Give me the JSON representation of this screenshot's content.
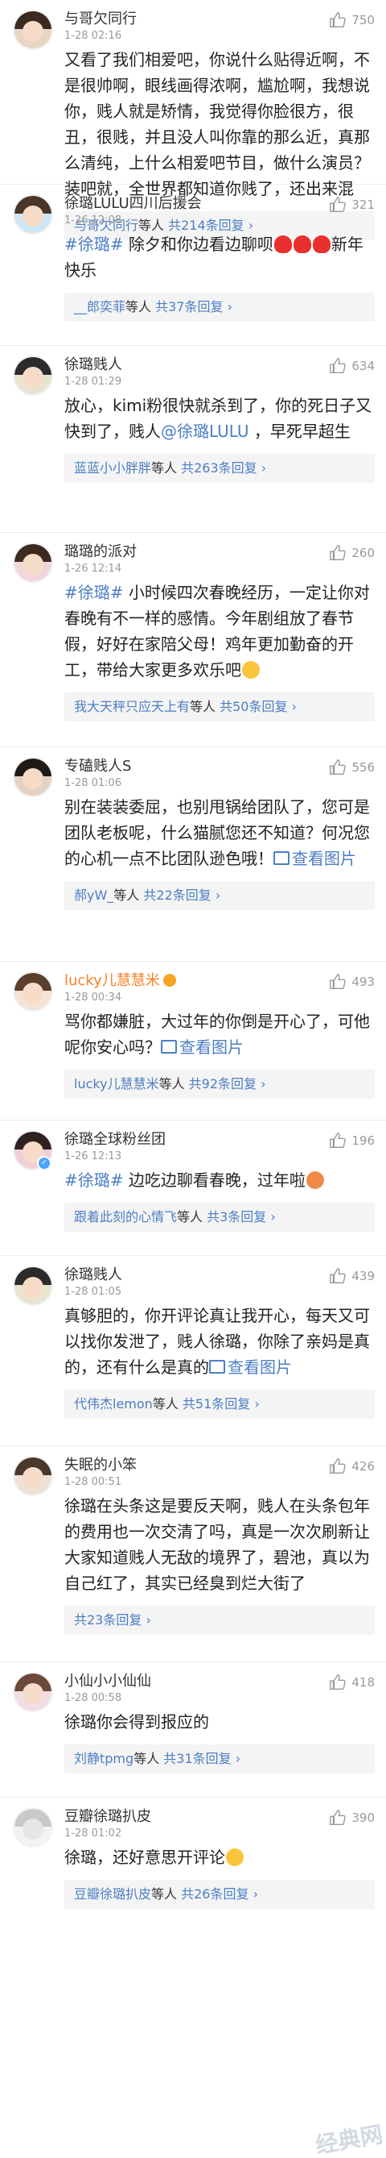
{
  "comments": [
    {
      "user": "与哥欠同行",
      "time": "1-28 02:16",
      "likes": "750",
      "text": "又看了我们相爱吧，你说什么贴得近啊，不是很帅啊，眼线画得浓啊，尴尬啊，我想说你，贱人就是矫情，我觉得你脸很方，很丑，很贱，并且没人叫你靠的那么近，真那么清纯，上什么相爱吧节目，做什么演员？装吧就，全世界都知道你贱了，还出来混",
      "reply_user": "与哥欠同行",
      "reply_mid": "等人 ",
      "reply_count": "共214条回复",
      "reply_arrow": "›"
    },
    {
      "user": "徐璐LULU四川后援会",
      "time": "1-26 12:08",
      "likes": "321",
      "topic": "#徐璐#",
      "text": " 除夕和你边看边聊呗",
      "text_after": "新年快乐",
      "reply_user": "__郎奕菲",
      "reply_mid": "等人 ",
      "reply_count": "共37条回复",
      "reply_arrow": "›"
    },
    {
      "user": "徐璐贱人",
      "time": "1-28 01:29",
      "likes": "634",
      "text": "放心，kimi粉很快就杀到了，你的死日子又快到了，贱人",
      "mention": "@徐璐LULU",
      "text_after": " ，早死早超生",
      "reply_user": "蓝蓝小小胖胖",
      "reply_mid": "等人 ",
      "reply_count": "共263条回复",
      "reply_arrow": "›"
    },
    {
      "user": "璐璐的派对",
      "time": "1-26 12:14",
      "likes": "260",
      "topic": "#徐璐#",
      "text": " 小时候四次春晚经历，一定让你对春晚有不一样的感情。今年剧组放了春节假，好好在家陪父母！鸡年更加勤奋的开工，带给大家更多欢乐吧",
      "reply_user": "我大天秤只应天上有",
      "reply_mid": "等人 ",
      "reply_count": "共50条回复",
      "reply_arrow": "›"
    },
    {
      "user": "专磕贱人S",
      "time": "1-28 01:06",
      "likes": "556",
      "text": "别在装装委屈，也别甩锅给团队了，您可是团队老板呢，什么猫腻您还不知道？何况您的心机一点不比团队逊色哦！",
      "img_label": "查看图片",
      "reply_user": "郝yW_",
      "reply_mid": "等人 ",
      "reply_count": "共22条回复",
      "reply_arrow": "›"
    },
    {
      "user": "lucky儿慧慧米",
      "time": "1-28 00:34",
      "likes": "493",
      "text": "骂你都嫌脏，大过年的你倒是开心了，可他呢你安心吗？",
      "img_label": "查看图片",
      "reply_user": "lucky儿慧慧米",
      "reply_mid": "等人 ",
      "reply_count": "共92条回复",
      "reply_arrow": "›"
    },
    {
      "user": "徐璐全球粉丝团",
      "time": "1-26 12:13",
      "likes": "196",
      "topic": "#徐璐#",
      "text": " 边吃边聊看春晚，过年啦",
      "reply_user": "跟着此刻的心情飞",
      "reply_mid": "等人 ",
      "reply_count": "共3条回复",
      "reply_arrow": "›"
    },
    {
      "user": "徐璐贱人",
      "time": "1-28 01:05",
      "likes": "439",
      "text": "真够胆的，你开评论真让我开心，每天又可以找你发泄了，贱人徐璐，你除了亲妈是真的，还有什么是真的",
      "img_label": "查看图片",
      "reply_user": "代伟杰lemon",
      "reply_mid": "等人 ",
      "reply_count": "共51条回复",
      "reply_arrow": "›"
    },
    {
      "user": "失眠的小笨",
      "time": "1-28 00:51",
      "likes": "426",
      "text": "徐璐在头条这是要反天啊，贱人在头条包年的费用也一次交清了吗，真是一次次刷新让大家知道贱人无敌的境界了，碧池，真以为自己红了，其实已经臭到烂大街了",
      "reply_user": "",
      "reply_mid": "",
      "reply_count": "共23条回复",
      "reply_arrow": "›"
    },
    {
      "user": "小仙小小仙仙",
      "time": "1-28 00:58",
      "likes": "418",
      "text": "徐璐你会得到报应的",
      "reply_user": "刘静tpmg",
      "reply_mid": "等人 ",
      "reply_count": "共31条回复",
      "reply_arrow": "›"
    },
    {
      "user": "豆瓣徐璐扒皮",
      "time": "1-28 01:02",
      "likes": "390",
      "text": "徐璐，还好意思开评论",
      "reply_user": "豆瓣徐璐扒皮",
      "reply_mid": "等人 ",
      "reply_count": "共26条回复",
      "reply_arrow": "›"
    }
  ],
  "watermark": "经典网",
  "colors": {
    "link": "#4c7ec4",
    "meta": "#999999",
    "reply_bg": "#f4f4f4",
    "orange_name": "#f7812a"
  }
}
